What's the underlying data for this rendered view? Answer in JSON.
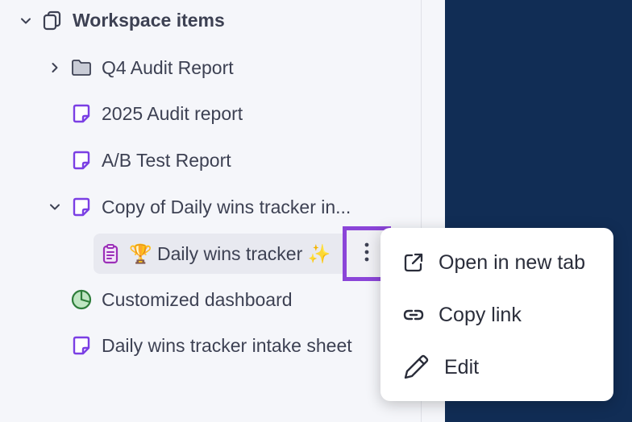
{
  "colors": {
    "dark_panel": "#112d55",
    "accent": "#8b45d8",
    "doc_icon": "#7b3fe4",
    "dashboard_icon": "#2e9a45"
  },
  "sidebar": {
    "header": {
      "label": "Workspace items",
      "icon": "stacked-docs-icon"
    },
    "items": [
      {
        "label": "Q4 Audit Report",
        "icon": "folder-icon",
        "expandable": true
      },
      {
        "label": "2025 Audit report",
        "icon": "doc-icon"
      },
      {
        "label": "A/B Test Report",
        "icon": "doc-icon"
      },
      {
        "label": "Copy of Daily wins tracker in...",
        "icon": "doc-icon",
        "expanded": true
      },
      {
        "label": "🏆 Daily wins tracker ✨",
        "icon": "form-icon",
        "selected": true
      },
      {
        "label": "Customized dashboard",
        "icon": "dashboard-icon"
      },
      {
        "label": "Daily wins tracker intake sheet",
        "icon": "doc-icon"
      }
    ]
  },
  "context_menu": {
    "items": [
      {
        "label": "Open in new tab",
        "icon": "external-link-icon"
      },
      {
        "label": "Copy link",
        "icon": "link-icon"
      },
      {
        "label": "Edit",
        "icon": "pencil-icon"
      }
    ]
  }
}
